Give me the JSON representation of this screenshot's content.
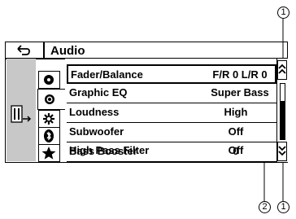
{
  "header": {
    "title": "Audio",
    "back_icon": "back-arrow-icon"
  },
  "rows": [
    {
      "label": "Fader/Balance",
      "value": "F/R  0 L/R  0"
    },
    {
      "label": "Graphic EQ",
      "value": "Super Bass"
    },
    {
      "label": "Loudness",
      "value": "High"
    },
    {
      "label": "Subwoofer",
      "value": "Off"
    },
    {
      "label": "Bass Booster",
      "value": "0"
    },
    {
      "label": "High Pass Filter",
      "value": "Off"
    }
  ],
  "tabs": [
    "disc-icon",
    "audio-icon",
    "settings-icon",
    "bluetooth-icon",
    "favorite-icon"
  ],
  "side_icon": "system-settings-icon",
  "callouts": {
    "scroll_buttons": "1",
    "scrollbar": "2"
  }
}
